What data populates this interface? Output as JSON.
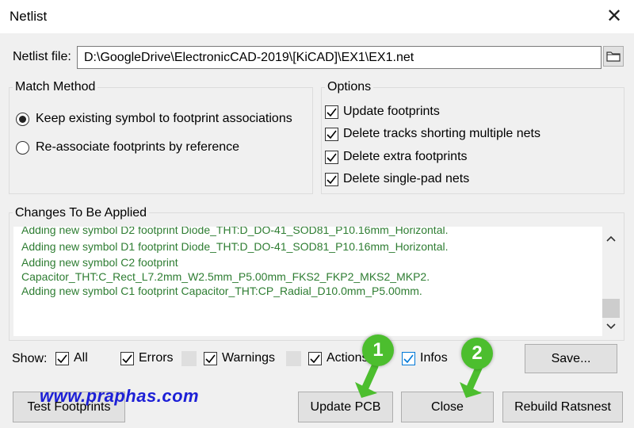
{
  "window": {
    "title": "Netlist",
    "close_glyph": "✕"
  },
  "netlist_file": {
    "label": "Netlist file:",
    "value": "D:\\GoogleDrive\\ElectronicCAD-2019\\[KiCAD]\\EX1\\EX1.net"
  },
  "match_method": {
    "title": "Match Method",
    "options": [
      {
        "label": "Keep existing symbol to footprint associations",
        "selected": true
      },
      {
        "label": "Re-associate footprints by reference",
        "selected": false
      }
    ]
  },
  "options": {
    "title": "Options",
    "items": [
      {
        "label": "Update footprints",
        "checked": true
      },
      {
        "label": "Delete tracks shorting multiple nets",
        "checked": true
      },
      {
        "label": "Delete extra footprints",
        "checked": true
      },
      {
        "label": "Delete single-pad nets",
        "checked": true
      }
    ]
  },
  "changes": {
    "title": "Changes To Be Applied",
    "log_color": "#2e7d32",
    "lines": [
      "Adding new symbol D2 footprint Diode_THT:D_DO-41_SOD81_P10.16mm_Horizontal.",
      "Adding new symbol D1 footprint Diode_THT:D_DO-41_SOD81_P10.16mm_Horizontal.",
      "Adding new symbol C2 footprint",
      "Capacitor_THT:C_Rect_L7.2mm_W2.5mm_P5.00mm_FKS2_FKP2_MKS2_MKP2.",
      "Adding new symbol C1 footprint Capacitor_THT:CP_Radial_D10.0mm_P5.00mm."
    ]
  },
  "show_filter": {
    "label": "Show:",
    "filters": [
      {
        "label": "All",
        "checked": true
      },
      {
        "label": "Errors",
        "checked": true
      },
      {
        "label": "Warnings",
        "checked": true
      },
      {
        "label": "Actions",
        "checked": true
      },
      {
        "label": "Infos",
        "checked": true
      }
    ],
    "save_label": "Save..."
  },
  "buttons": {
    "test_footprints": "Test Footprints",
    "update_pcb": "Update PCB",
    "close": "Close",
    "rebuild_ratsnest": "Rebuild Ratsnest"
  },
  "annotations": {
    "watermark": "www.praphas.com",
    "badge1": "1",
    "badge2": "2",
    "badge_color": "#4cbe2e"
  }
}
